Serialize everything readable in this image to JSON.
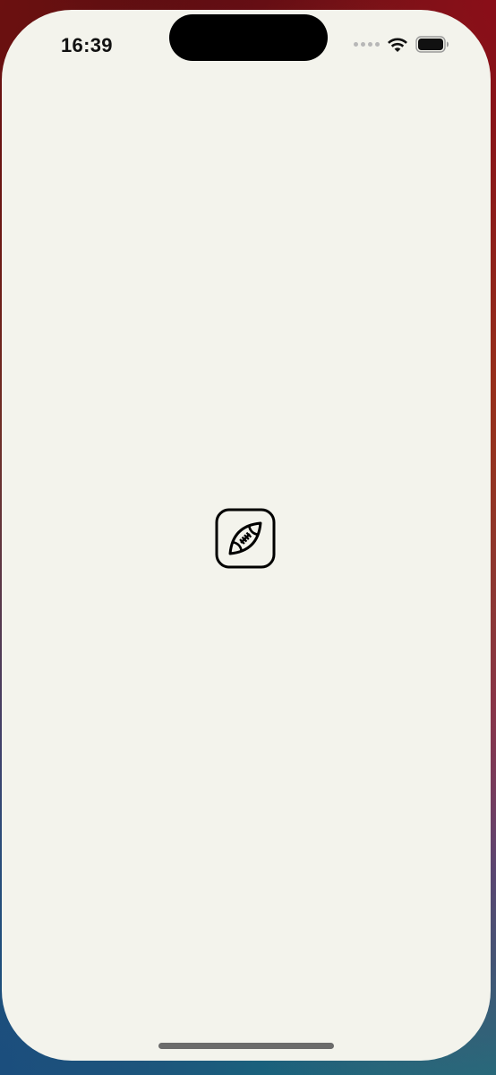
{
  "status_bar": {
    "time": "16:39",
    "signal_icon": "signal-dots-icon",
    "wifi_icon": "wifi-icon",
    "battery_icon": "battery-icon"
  },
  "screen": {
    "background_color": "#f3f3ec",
    "logo_icon": "american-football-icon",
    "logo_color": "#000000"
  },
  "system": {
    "home_indicator_color": "#6b6b6b"
  }
}
